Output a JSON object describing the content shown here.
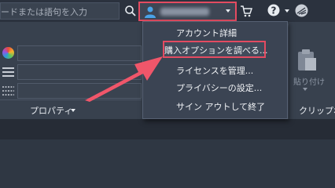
{
  "search": {
    "placeholder": "ードまたは語句を入力"
  },
  "account": {
    "name_hidden": ""
  },
  "menu": {
    "items": [
      {
        "label": "アカウント詳細"
      },
      {
        "label": "購入オプションを調べる..."
      },
      {
        "label": "ライセンスを管理..."
      },
      {
        "label": "プライバシーの設定..."
      },
      {
        "label": "サイン アウトして終了"
      }
    ]
  },
  "ribbon": {
    "properties_label": "プロパティ",
    "paste_label": "貼り付け",
    "clipboard_label": "クリップボ"
  },
  "colors": {
    "highlight": "#e44b61",
    "arrow": "#f0566a",
    "background": "#3b4453"
  },
  "icons": [
    "search-icon",
    "user-icon",
    "cart-icon",
    "help-icon",
    "autodesk-icon",
    "color-wheel-icon",
    "paste-icon"
  ]
}
